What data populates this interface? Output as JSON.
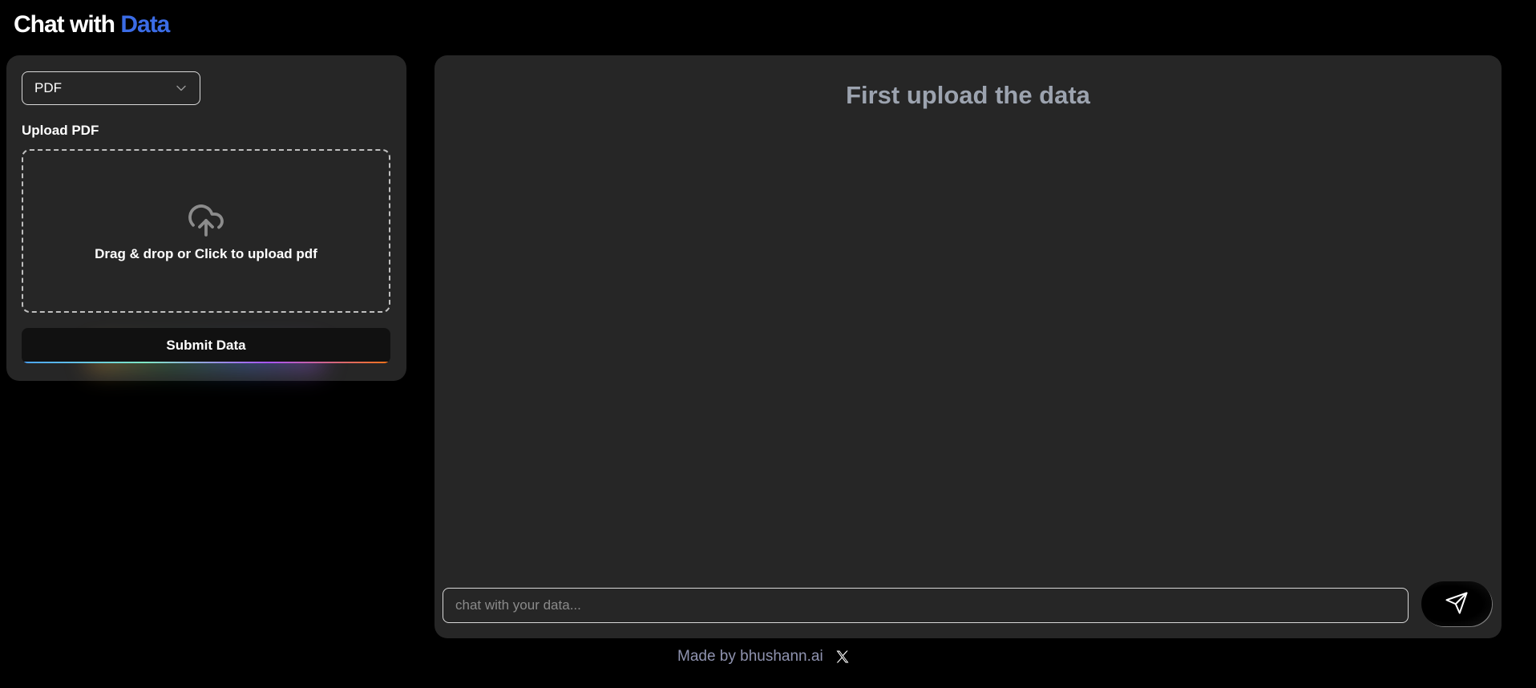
{
  "header": {
    "title_main": "Chat with",
    "title_accent": "Data",
    "accent_color": "#3b6ce6"
  },
  "sidebar": {
    "source_select": {
      "selected": "PDF"
    },
    "upload_label": "Upload PDF",
    "dropzone": {
      "icon": "cloud-upload-icon",
      "text": "Drag & drop or Click to upload pdf"
    },
    "submit_label": "Submit Data"
  },
  "chat": {
    "heading": "First upload the data",
    "input_placeholder": "chat with your data...",
    "input_value": "",
    "send_icon": "send-icon"
  },
  "footer": {
    "text": "Made by bhushann.ai",
    "social_icon": "x-logo-icon"
  }
}
